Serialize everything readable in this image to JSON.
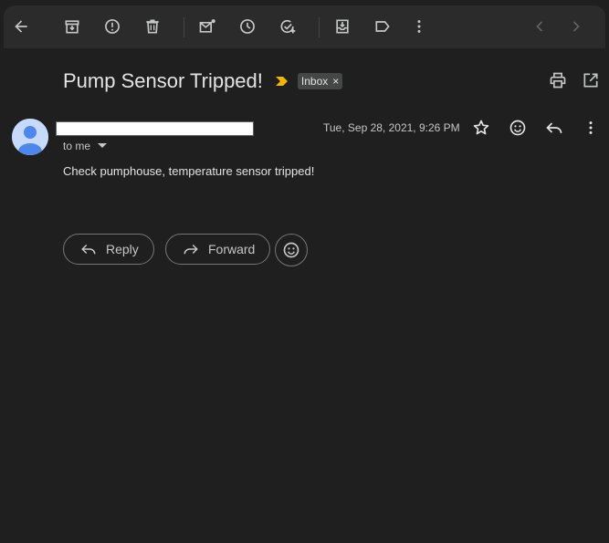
{
  "toolbar": {
    "icons": [
      "back-arrow-icon",
      "archive-icon",
      "report-spam-icon",
      "delete-icon",
      "mark-unread-icon",
      "snooze-icon",
      "add-to-tasks-icon",
      "move-to-icon",
      "label-icon",
      "more-vert-icon",
      "prev-icon",
      "next-icon"
    ]
  },
  "email": {
    "subject": "Pump Sensor Tripped!",
    "label_chip": "Inbox",
    "label_remove": "×",
    "sender_name": "",
    "recipient": "to me",
    "date": "Tue, Sep 28, 2021, 9:26 PM",
    "body": "Check pumphouse, temperature sensor tripped!"
  },
  "actions": {
    "reply_label": "Reply",
    "forward_label": "Forward"
  },
  "colors": {
    "background": "#1f1f1f",
    "toolbar": "#2b2b2b",
    "importance_marker": "#f2b600",
    "chip": "#444746"
  }
}
